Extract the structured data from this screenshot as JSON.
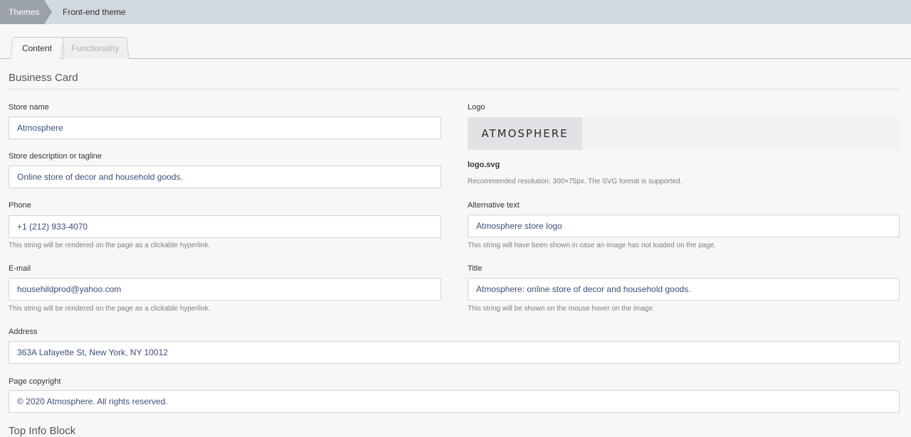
{
  "breadcrumb": {
    "root": "Themes",
    "current": "Front-end theme"
  },
  "tabs": [
    {
      "label": "Content",
      "active": true
    },
    {
      "label": "Functionality",
      "active": false
    }
  ],
  "section": {
    "title": "Business Card"
  },
  "fields": {
    "store_name": {
      "label": "Store name",
      "value": "Atmosphere"
    },
    "tagline": {
      "label": "Store description or tagline",
      "value": "Online store of decor and household goods."
    },
    "phone": {
      "label": "Phone",
      "value": "+1 (212) 933-4070",
      "hint": "This string will be rendered on the page as a clickable hyperlink."
    },
    "email": {
      "label": "E-mail",
      "value": "househildprod@yahoo.com",
      "hint": "This string will be rendered on the page as a clickable hyperlink."
    },
    "address": {
      "label": "Address",
      "value": "363A Lafayette St, New York, NY 10012"
    },
    "copyright": {
      "label": "Page copyright",
      "value": "© 2020 Atmosphere. All rights reserved."
    },
    "logo": {
      "label": "Logo",
      "image_text": "ATMOSPHERE",
      "filename": "logo.svg",
      "hint": "Recommended resolution: 300×75px. The SVG format is supported."
    },
    "alt_text": {
      "label": "Alternative text",
      "value": "Atmosphere store logo",
      "hint": "This string will have been shown in case an image has not loaded on the page."
    },
    "title": {
      "label": "Title",
      "value": "Atmosphere: online store of decor and household goods.",
      "hint": "This string will be shown on the mouse hover on the image."
    }
  },
  "next_section": {
    "title": "Top Info Block"
  }
}
